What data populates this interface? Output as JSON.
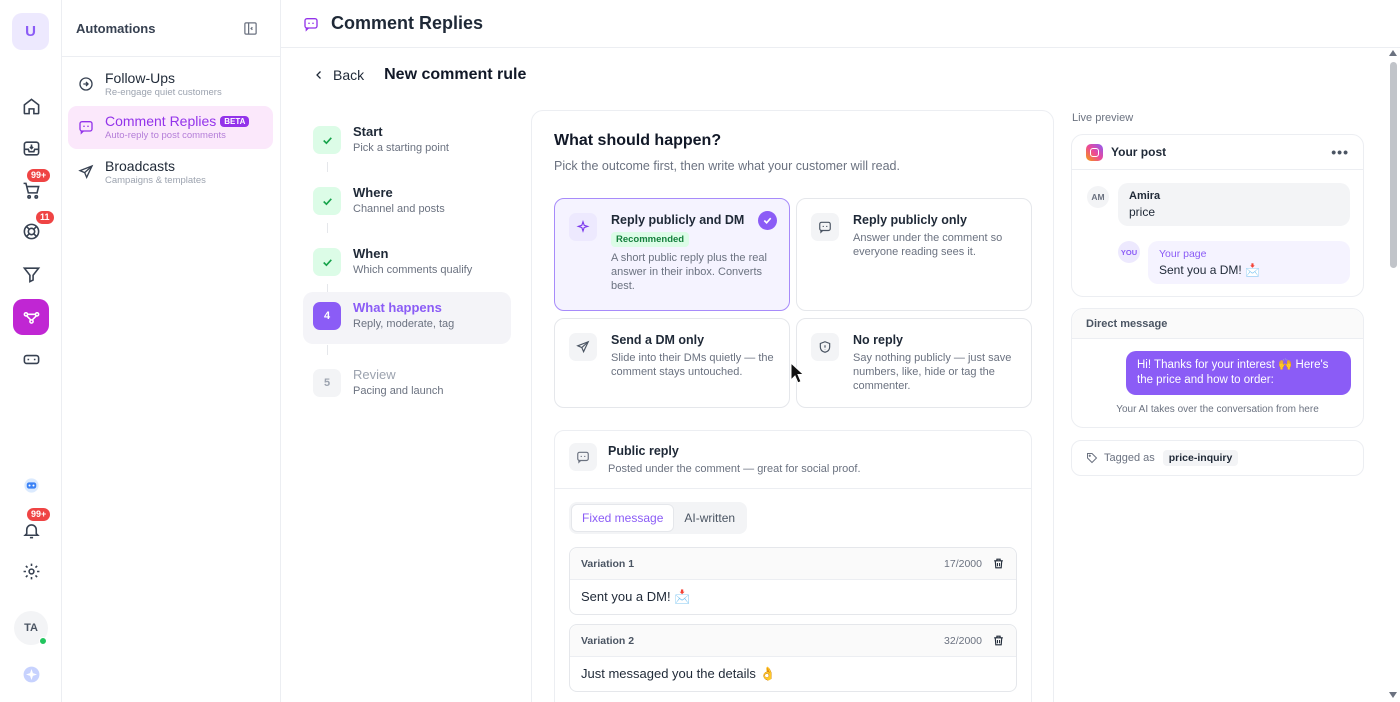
{
  "rail": {
    "workspace_initial": "U",
    "cart_badge": "99+",
    "support_badge": "11",
    "notifications_badge": "99+",
    "user_initials": "TA"
  },
  "sidebar": {
    "title": "Automations",
    "items": [
      {
        "label": "Follow-Ups",
        "sub": "Re-engage quiet customers"
      },
      {
        "label": "Comment Replies",
        "sub": "Auto-reply to post comments",
        "badge": "BETA"
      },
      {
        "label": "Broadcasts",
        "sub": "Campaigns & templates"
      }
    ]
  },
  "topbar": {
    "title": "Comment Replies"
  },
  "subhead": {
    "back_label": "Back",
    "title": "New comment rule"
  },
  "steps": [
    {
      "title": "Start",
      "sub": "Pick a starting point",
      "number": ""
    },
    {
      "title": "Where",
      "sub": "Channel and posts",
      "number": ""
    },
    {
      "title": "When",
      "sub": "Which comments qualify",
      "number": ""
    },
    {
      "title": "What happens",
      "sub": "Reply, moderate, tag",
      "number": "4"
    },
    {
      "title": "Review",
      "sub": "Pacing and launch",
      "number": "5"
    }
  ],
  "main": {
    "title": "What should happen?",
    "subtitle": "Pick the outcome first, then write what your customer will read.",
    "options": [
      {
        "title": "Reply publicly and DM",
        "badge": "Recommended",
        "desc": "A short public reply plus the real answer in their inbox. Converts best."
      },
      {
        "title": "Reply publicly only",
        "desc": "Answer under the comment so everyone reading sees it."
      },
      {
        "title": "Send a DM only",
        "desc": "Slide into their DMs quietly — the comment stays untouched."
      },
      {
        "title": "No reply",
        "desc": "Say nothing publicly — just save numbers, like, hide or tag the commenter."
      }
    ],
    "public_reply": {
      "title": "Public reply",
      "subtitle": "Posted under the comment — great for social proof.",
      "tabs": [
        "Fixed message",
        "AI-written"
      ],
      "variations": [
        {
          "label": "Variation 1",
          "count": "17/2000",
          "text": "Sent you a DM! 📩"
        },
        {
          "label": "Variation 2",
          "count": "32/2000",
          "text": "Just messaged you the details 👌"
        }
      ]
    }
  },
  "preview": {
    "label": "Live preview",
    "post": {
      "title": "Your post",
      "commenter_initials": "AM",
      "commenter_name": "Amira",
      "comment_text": "price",
      "reply_initials": "YOU",
      "reply_name": "Your page",
      "reply_text": "Sent you a DM! 📩"
    },
    "dm": {
      "title": "Direct message",
      "message": "Hi! Thanks for your interest 🙌 Here's the price and how to order:",
      "footer": "Your AI takes over the conversation from here"
    },
    "tag": {
      "label": "Tagged as",
      "value": "price-inquiry"
    }
  }
}
